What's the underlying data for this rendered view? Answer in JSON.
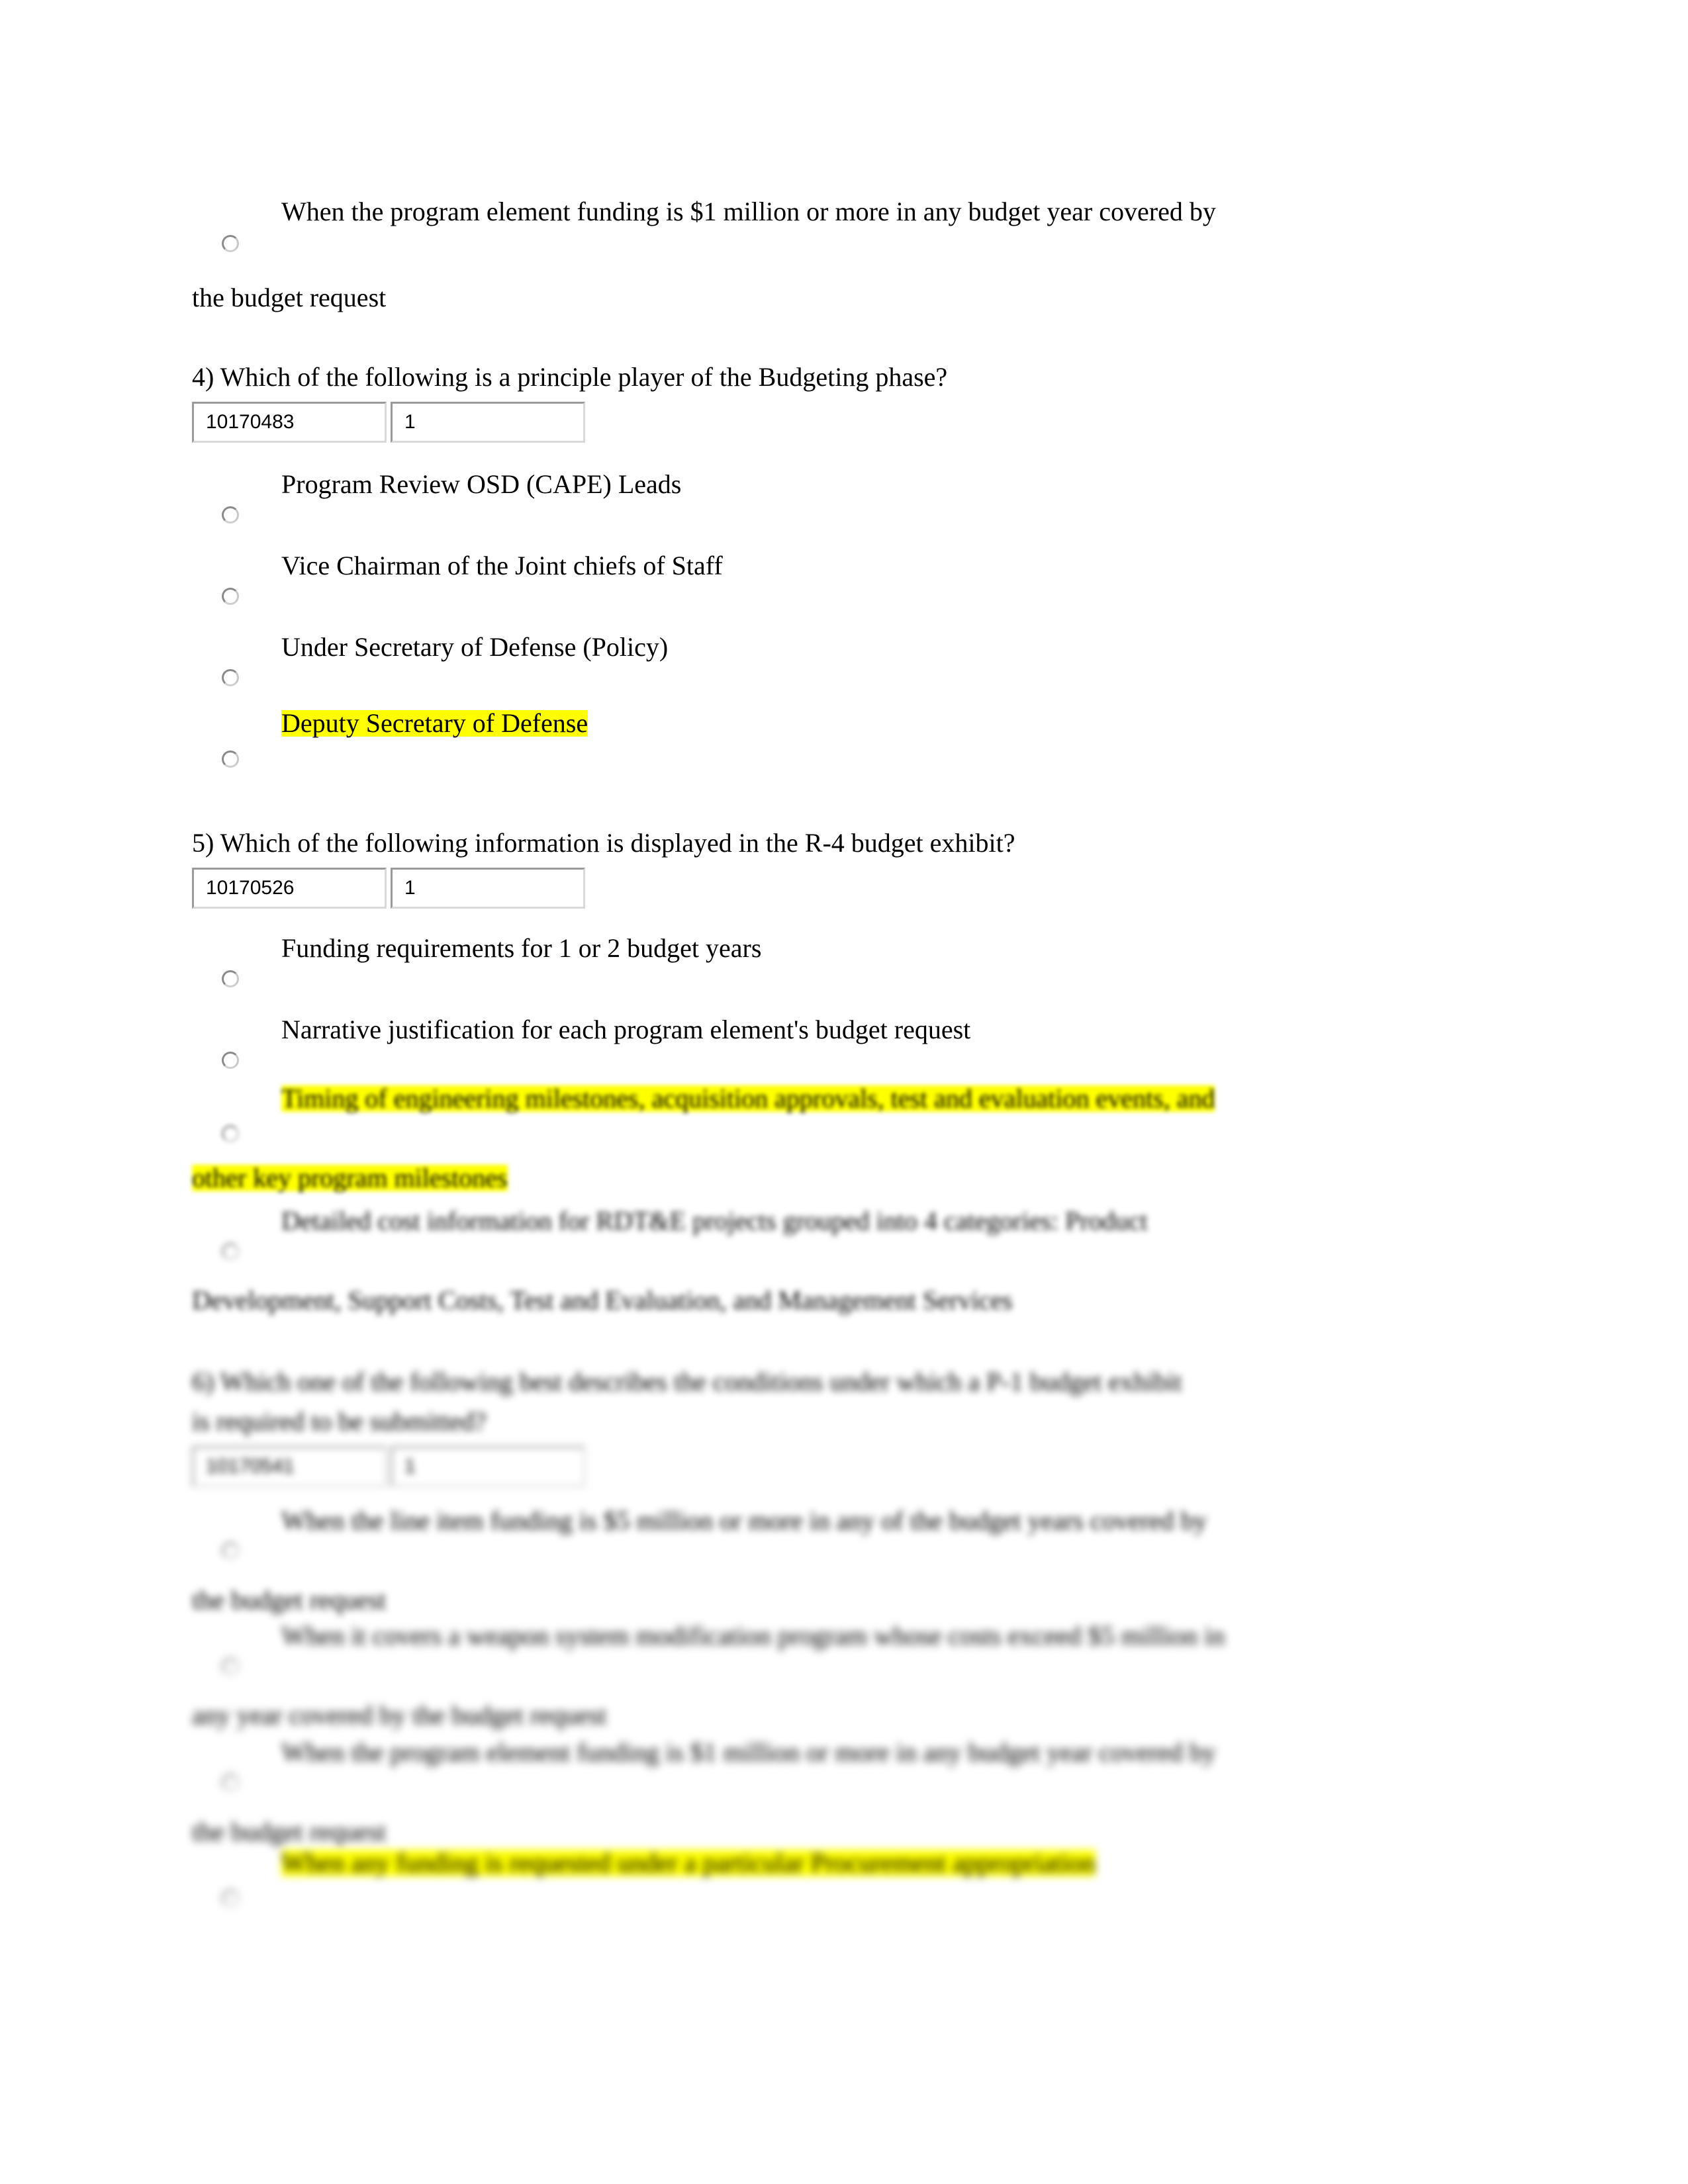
{
  "document": {
    "type": "multiple-choice-quiz-page",
    "highlight_color": "#ffff00",
    "background_color": "#ffffff",
    "text_color": "#000000"
  },
  "carryover_option": {
    "line1": "When the program element funding is $1 million or more in any budget year covered by",
    "line2": "the budget request"
  },
  "questions": [
    {
      "number": "4)",
      "prompt": "4)  Which of the following is a principle player of the Budgeting phase?",
      "id_table": {
        "id": "10170483",
        "points": "1"
      },
      "options": [
        {
          "label": "Program Review OSD (CAPE) Leads",
          "highlighted": false
        },
        {
          "label": "Vice Chairman of the Joint chiefs of Staff",
          "highlighted": false
        },
        {
          "label": "Under Secretary of Defense (Policy)",
          "highlighted": false
        },
        {
          "label": "Deputy Secretary of Defense",
          "highlighted": true
        }
      ]
    },
    {
      "number": "5)",
      "prompt": "5)  Which of the following information is displayed in the R-4 budget exhibit?",
      "id_table": {
        "id": "10170526",
        "points": "1"
      },
      "options": [
        {
          "label": "Funding requirements for 1 or 2 budget years",
          "highlighted": false
        },
        {
          "label": "Narrative justification for each program element's budget request",
          "highlighted": false
        },
        {
          "line1": "Timing of engineering milestones, acquisition approvals, test and evaluation events, and",
          "line2": "other key program milestones",
          "highlighted": true
        },
        {
          "line1": "Detailed cost information for RDT&E projects grouped into 4 categories: Product",
          "line2": "Development, Support Costs, Test and Evaluation, and Management Services",
          "highlighted": false
        }
      ]
    },
    {
      "number": "6)",
      "prompt_line1": "6)  Which one of the following best describes the conditions under which a P-1 budget exhibit",
      "prompt_line2": "is required to be submitted?",
      "id_table": {
        "id": "10170541",
        "points": "1"
      },
      "options": [
        {
          "line1": "When the line item funding is $5 million or more in any of the budget years covered by",
          "line2": "the budget request",
          "highlighted": false
        },
        {
          "line1": "When it covers a weapon system modification program whose costs exceed $5 million in",
          "line2": "any year covered by the budget request",
          "highlighted": false
        },
        {
          "line1": "When the program element funding is $1 million or more in any budget year covered by",
          "line2": "the budget request",
          "highlighted": false
        },
        {
          "line1": "When any funding is requested under a particular Procurement appropriation",
          "highlighted": true
        }
      ]
    }
  ]
}
